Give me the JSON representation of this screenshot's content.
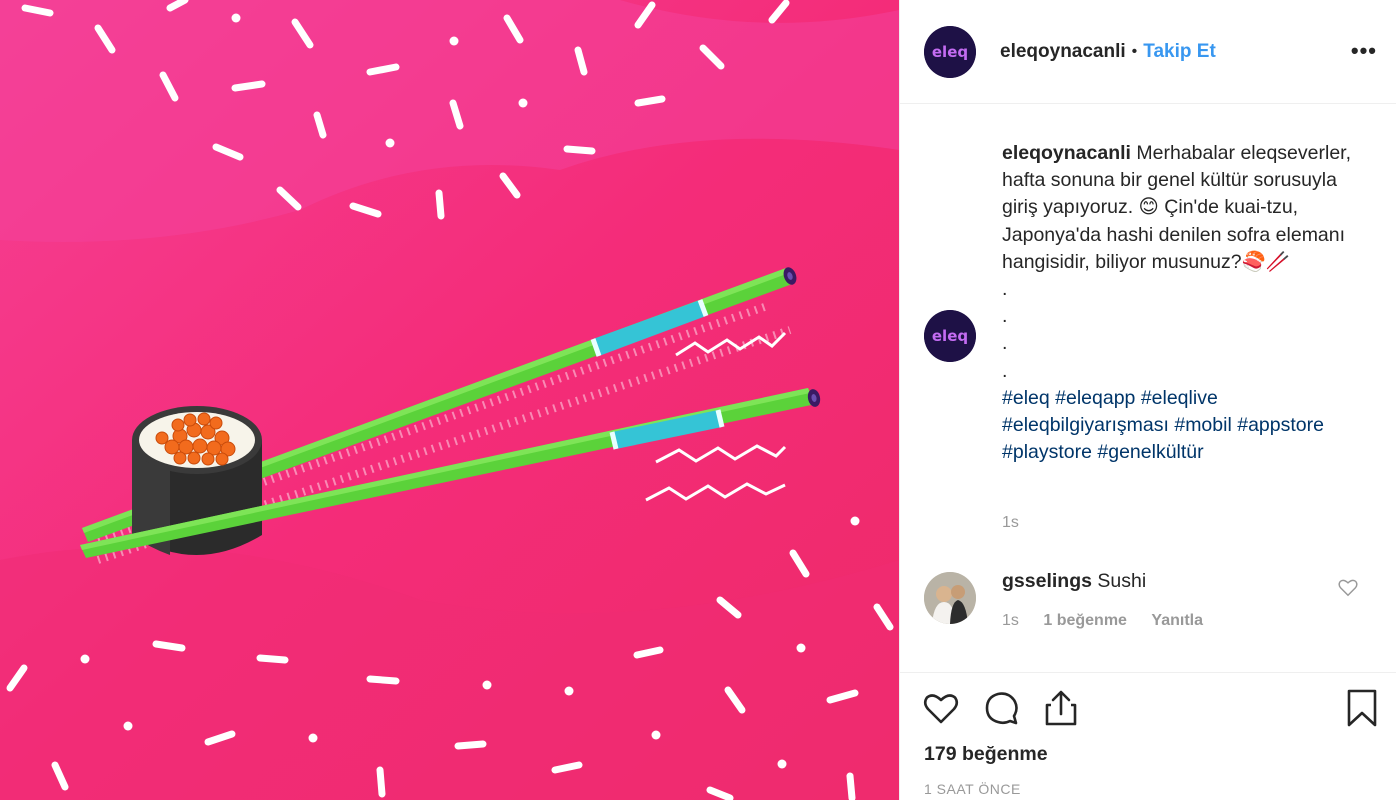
{
  "post": {
    "username": "eleqoynacanli",
    "follow_label": "Takip Et",
    "separator": "•",
    "more_label": "•••",
    "avatar_text": "eleq"
  },
  "caption": {
    "username": "eleqoynacanli",
    "text": "Merhabalar eleqseverler, hafta sonuna bir genel kültür sorusuyla giriş yapıyoruz. 😊 Çin'de kuai-tzu, Japonya'da hashi denilen sofra elemanı hangisidir, biliyor musunuz?🍣🥢",
    "dots": [
      ".",
      ".",
      ".",
      "."
    ],
    "hashtags": [
      "#eleq",
      "#eleqapp",
      "#eleqlive",
      "#eleqbilgiyarışması",
      "#mobil",
      "#appstore",
      "#playstore",
      "#genelkültür"
    ],
    "time": "1s"
  },
  "comment": {
    "username": "gsselings",
    "text": "Sushi",
    "time": "1s",
    "likes": "1 beğenme",
    "reply_label": "Yanıtla"
  },
  "footer": {
    "likes": "179 beğenme",
    "ago": "1 SAAT ÖNCE"
  },
  "colors": {
    "background_pink": "#f0357a",
    "link_blue": "#3897f0",
    "hashtag_blue": "#003569",
    "chopstick_green": "#5bd23a",
    "chopstick_teal": "#35c4d6"
  }
}
